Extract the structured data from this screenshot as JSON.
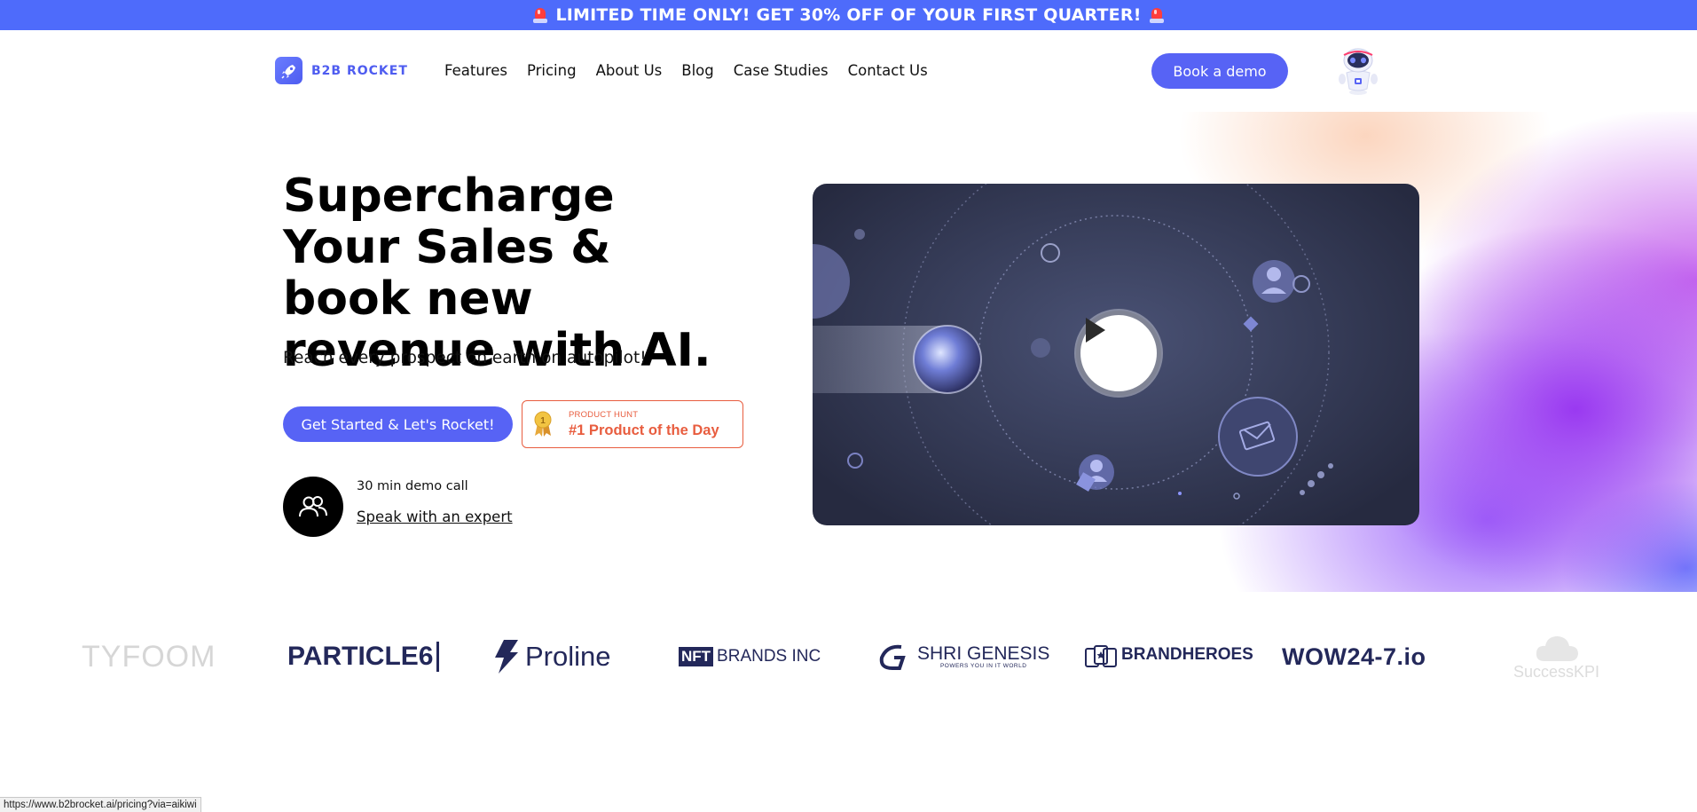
{
  "promo": {
    "text": "LIMITED TIME ONLY! GET 30% OFF OF YOUR FIRST QUARTER!",
    "icon": "siren-icon"
  },
  "header": {
    "logo_text": "B2B ROCKET",
    "nav": [
      "Features",
      "Pricing",
      "About Us",
      "Blog",
      "Case Studies",
      "Contact Us"
    ],
    "cta_label": "Book a demo"
  },
  "hero": {
    "headline_bold": "Supercharge Your Sales",
    "headline_rest": " & book new revenue with AI.",
    "subhead": "Reach every prospect on earth on autopilot!",
    "primary_cta": "Get Started & Let's Rocket!",
    "badge": {
      "small": "PRODUCT HUNT",
      "big": "#1 Product of the Day",
      "medal_number": "1"
    },
    "expert": {
      "caption": "30 min demo call",
      "link": "Speak with an expert"
    }
  },
  "logos": {
    "tyfoom": "TYFOOM",
    "particle": "PARTICLE6",
    "proline": "Proline",
    "brands_nft": "NFT",
    "brands_rest": "BRANDS INC",
    "shri_main": "SHRI GENESIS",
    "shri_tag": "POWERS YOU IN IT WORLD",
    "brandheroes": "BRANDHEROES",
    "wow": "WOW24-7.io",
    "success": "SuccessKPI"
  },
  "status_url": "https://www.b2brocket.ai/pricing?via=aikiwi",
  "colors": {
    "accent": "#5763f5",
    "promo_bg": "#4e6bfb",
    "badge": "#e85d3f",
    "logo_navy": "#23285a"
  }
}
